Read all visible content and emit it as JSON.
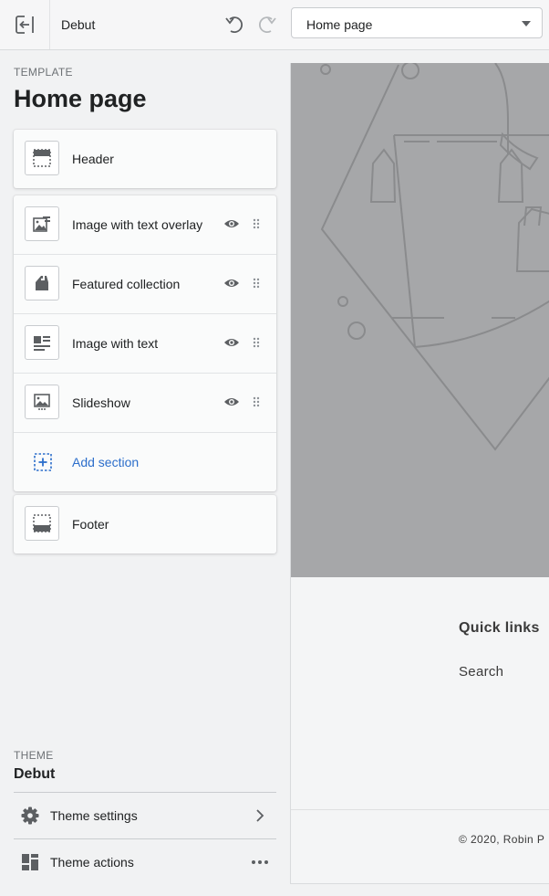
{
  "topbar": {
    "store_name": "Debut",
    "template_select": {
      "value": "Home page"
    }
  },
  "sidebar": {
    "template_kicker": "TEMPLATE",
    "template_title": "Home page",
    "header_label": "Header",
    "sections": [
      {
        "label": "Image with text overlay",
        "icon": "image-with-text-overlay-icon"
      },
      {
        "label": "Featured collection",
        "icon": "tag-icon"
      },
      {
        "label": "Image with text",
        "icon": "image-with-text-icon"
      },
      {
        "label": "Slideshow",
        "icon": "slideshow-icon"
      }
    ],
    "add_section_label": "Add section",
    "footer_label": "Footer",
    "theme_kicker": "THEME",
    "theme_name": "Debut",
    "theme_settings_label": "Theme settings",
    "theme_actions_label": "Theme actions"
  },
  "preview": {
    "quick_links_title": "Quick links",
    "quick_link_search": "Search",
    "copyright": "© 2020, Robin P"
  },
  "colors": {
    "link": "#2c6ecb",
    "hero_bg": "#a6a7a9",
    "icon": "#5c5f62"
  }
}
